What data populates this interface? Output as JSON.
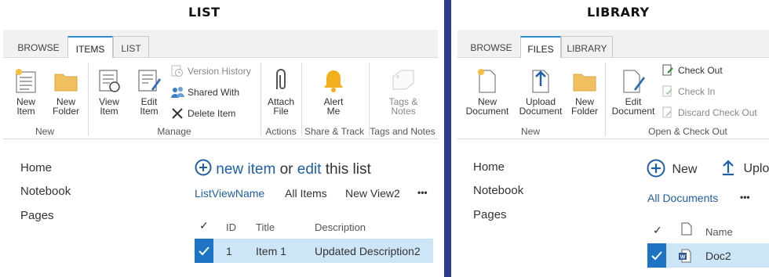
{
  "list": {
    "title": "LIST",
    "tabs": [
      {
        "label": "BROWSE",
        "active": false
      },
      {
        "label": "ITEMS",
        "active": true
      },
      {
        "label": "LIST",
        "active": false
      }
    ],
    "groups": {
      "new": {
        "label": "New",
        "new_item_label": "New\nItem",
        "new_folder_label": "New\nFolder"
      },
      "manage": {
        "label": "Manage",
        "view_item_label": "View\nItem",
        "edit_item_label": "Edit\nItem",
        "version_history_label": "Version History",
        "shared_with_label": "Shared With",
        "delete_item_label": "Delete Item"
      },
      "actions": {
        "label": "Actions",
        "attach_file_label": "Attach\nFile"
      },
      "share_track": {
        "label": "Share & Track",
        "alert_me_label": "Alert\nMe"
      },
      "tags_notes": {
        "label": "Tags and Notes",
        "tags_notes_label": "Tags &\nNotes"
      }
    },
    "nav": [
      "Home",
      "Notebook",
      "Pages"
    ],
    "header": {
      "new_item_link": "new item",
      "or_text": "or",
      "edit_link": "edit",
      "this_list_text": "this list"
    },
    "views": [
      "ListViewName",
      "All Items",
      "New View2"
    ],
    "more_label": "•••",
    "table": {
      "columns": [
        "ID",
        "Title",
        "Description"
      ],
      "rows": [
        {
          "id": "1",
          "title": "Item 1",
          "description": "Updated Description2"
        }
      ]
    }
  },
  "library": {
    "title": "LIBRARY",
    "tabs": [
      {
        "label": "BROWSE",
        "active": false
      },
      {
        "label": "FILES",
        "active": true
      },
      {
        "label": "LIBRARY",
        "active": false
      }
    ],
    "groups": {
      "new": {
        "label": "New",
        "new_document_label": "New\nDocument",
        "upload_document_label": "Upload\nDocument",
        "new_folder_label": "New\nFolder"
      },
      "open_checkout": {
        "label": "Open & Check Out",
        "edit_document_label": "Edit\nDocument",
        "check_out_label": "Check Out",
        "check_in_label": "Check In",
        "discard_check_out_label": "Discard Check Out"
      }
    },
    "nav": [
      "Home",
      "Notebook",
      "Pages"
    ],
    "header": {
      "new_label": "New",
      "upload_label": "Uplo"
    },
    "views": [
      "All Documents"
    ],
    "more_label": "•••",
    "table": {
      "columns": [
        "Name"
      ],
      "rows": [
        {
          "name": "Doc2"
        }
      ]
    }
  },
  "colors": {
    "accent": "#1e5fa8",
    "tab_active_top": "#2e8ecf",
    "selection_row": "#cde6f7",
    "selection_check": "#1e74c4",
    "divider": "#2b3a8f",
    "folder": "#f0c060",
    "bell": "#f2b01e"
  }
}
